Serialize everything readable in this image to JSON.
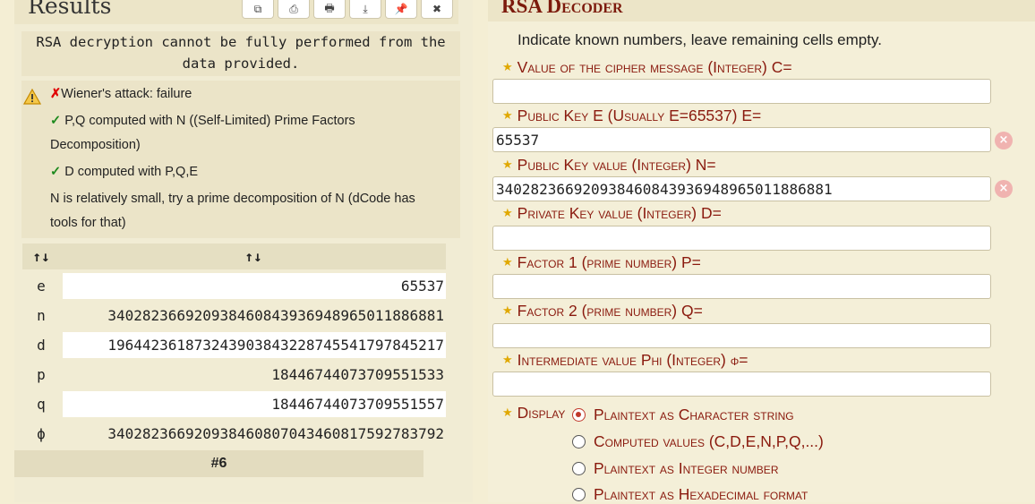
{
  "left": {
    "title": "Results",
    "toolbar_icons": [
      "copy-icon",
      "print-icon",
      "printer-icon",
      "download-icon",
      "pin-icon",
      "close-icon"
    ],
    "toolbar_glyphs": [
      "⧉",
      "⎙",
      "🖶",
      "⤓",
      "📌",
      "✖"
    ],
    "message_line1": "RSA decryption cannot be fully performed from the",
    "message_line2": "data provided.",
    "wiener_mark": "✗",
    "wiener": "Wiener's attack: failure",
    "check_mark": "✓",
    "pq_line1": "P,Q computed with N ((Self-Limited) Prime Factors",
    "pq_line2": "Decomposition)",
    "d_computed": "D computed with P,Q,E",
    "note_line1": "N is relatively small, try a prime decomposition of N (dCode has",
    "note_line2": "tools for that)",
    "sort_glyph": "↑↓",
    "rows": [
      {
        "label": "e",
        "value": "65537"
      },
      {
        "label": "n",
        "value": "340282366920938460843936948965011886881"
      },
      {
        "label": "d",
        "value": "196442361873243903843228745541797845217"
      },
      {
        "label": "p",
        "value": "18446744073709551533"
      },
      {
        "label": "q",
        "value": "18446744073709551557"
      },
      {
        "label": "ϕ",
        "value": "340282366920938460807043460817592783792"
      }
    ],
    "pager": "#6"
  },
  "right": {
    "title": "RSA Decoder",
    "instruction": "Indicate known numbers, leave remaining cells empty.",
    "fields": [
      {
        "label": "Value of the cipher message (Integer) C=",
        "value": ""
      },
      {
        "label": "Public Key E (Usually E=65537) E=",
        "value": "65537"
      },
      {
        "label": "Public Key value (Integer) N=",
        "value": "340282366920938460843936948965011886881"
      },
      {
        "label": "Private Key value (Integer) D=",
        "value": ""
      },
      {
        "label": "Factor 1 (prime number) P=",
        "value": ""
      },
      {
        "label": "Factor 2 (prime number) Q=",
        "value": ""
      },
      {
        "label": "Intermediate value Phi (Integer) ϕ=",
        "value": ""
      }
    ],
    "clear_glyph": "×",
    "display_label": "Display",
    "display_options": [
      {
        "label": "Plaintext as Character string",
        "selected": true
      },
      {
        "label": "Computed values (C,D,E,N,P,Q,...)",
        "selected": false
      },
      {
        "label": "Plaintext as Integer number",
        "selected": false
      },
      {
        "label": "Plaintext as Hexadecimal format",
        "selected": false
      }
    ],
    "accent_color": "#8a1a0e",
    "star_color": "#e0a800"
  }
}
